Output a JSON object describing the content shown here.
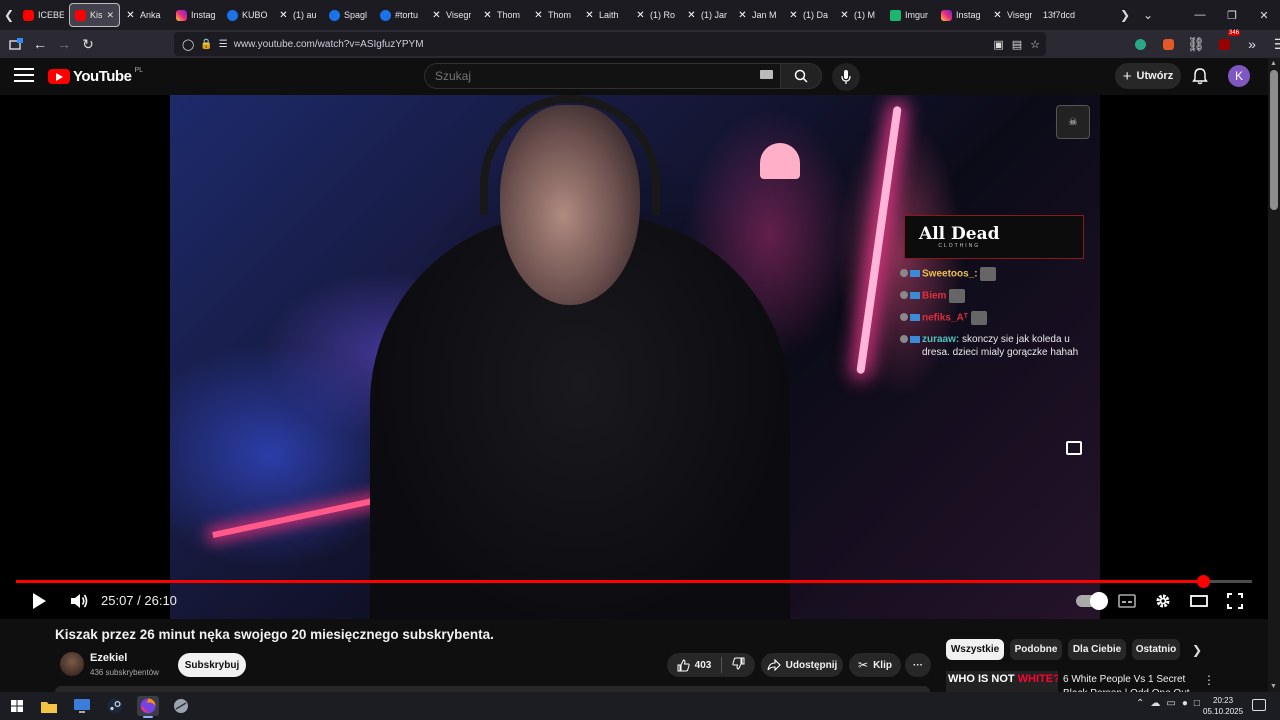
{
  "browser": {
    "tabs": [
      {
        "label": "ICEBE",
        "favicon": "youtube"
      },
      {
        "label": "Kis",
        "favicon": "youtube",
        "active": true
      },
      {
        "label": "Anka",
        "favicon": "x"
      },
      {
        "label": "Instag",
        "favicon": "instagram"
      },
      {
        "label": "KUBO",
        "favicon": "blue"
      },
      {
        "label": "(1) au",
        "favicon": "x"
      },
      {
        "label": "Spagl",
        "favicon": "blue"
      },
      {
        "label": "#tortu",
        "favicon": "blue"
      },
      {
        "label": "Visegr",
        "favicon": "x"
      },
      {
        "label": "Thom",
        "favicon": "x"
      },
      {
        "label": "Thom",
        "favicon": "x"
      },
      {
        "label": "Laith",
        "favicon": "x"
      },
      {
        "label": "(1) Ro",
        "favicon": "x"
      },
      {
        "label": "(1) Jar",
        "favicon": "x"
      },
      {
        "label": "Jan M",
        "favicon": "x"
      },
      {
        "label": "(1) Da",
        "favicon": "x"
      },
      {
        "label": "(1) M",
        "favicon": "x"
      },
      {
        "label": "Imgur",
        "favicon": "imgur"
      },
      {
        "label": "Instag",
        "favicon": "instagram"
      },
      {
        "label": "Visegr",
        "favicon": "x"
      },
      {
        "label": "13f7dcd",
        "favicon": "none"
      }
    ],
    "url": "www.youtube.com/watch?v=ASIgfuzYPYM",
    "extension_badge": "346"
  },
  "youtube": {
    "logo_text": "YouTube",
    "region": "PL",
    "search_placeholder": "Szukaj",
    "create_label": "Utwórz",
    "avatar_letter": "K"
  },
  "player": {
    "current_time": "25:07",
    "duration": "26:10",
    "time_display": "25:07 / 26:10",
    "progress_fraction": 0.96,
    "chat": {
      "banner_title": "All Dead",
      "banner_sub": "CLOTHING",
      "lines": [
        {
          "user": "Sweetoos_:",
          "color": "#e8c14a",
          "message": ""
        },
        {
          "user": "Biem",
          "color": "#e0303a",
          "message": ""
        },
        {
          "user": "nefiks_Aᵀ",
          "color": "#d8303a",
          "message": ""
        },
        {
          "user": "zuraaw:",
          "color": "#4fc3c0",
          "message": "skonczy sie jak koleda u dresa. dzieci mialy gorączke hahah"
        }
      ]
    }
  },
  "video": {
    "title": "Kiszak przez 26 minut nęka swojego 20 miesięcznego subskrybenta.",
    "channel_name": "Ezekiel",
    "channel_subs": "436 subskrybentów",
    "subscribe_label": "Subskrybuj",
    "likes": "403",
    "share_label": "Udostępnij",
    "clip_label": "Klip",
    "more_label": "···"
  },
  "chips": [
    "Wszystkie",
    "Podobne",
    "Dla Ciebie",
    "Ostatnio"
  ],
  "recommendation": {
    "thumb_text_white": "WHO IS NOT ",
    "thumb_text_red": "WHITE?",
    "title": "6 White People Vs 1 Secret Black Person | Odd One Out"
  },
  "taskbar": {
    "time": "20:23",
    "date": "05.10.2025"
  }
}
